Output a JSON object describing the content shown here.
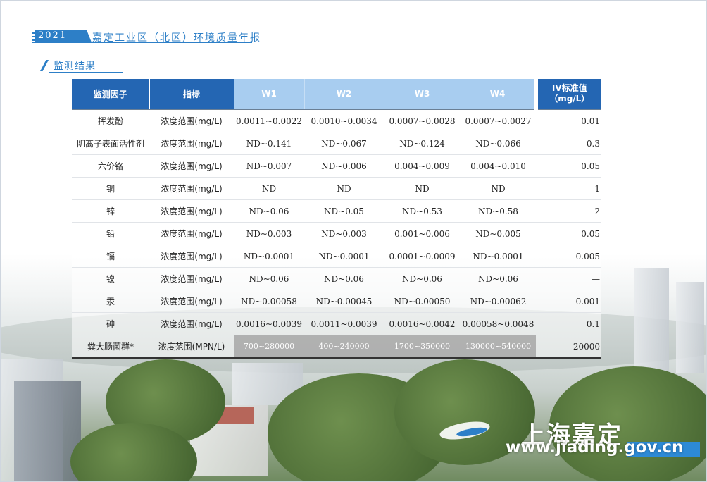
{
  "header": {
    "year": "2021",
    "title": "嘉定工业区（北区）环境质量年报"
  },
  "section": {
    "title": "监测结果"
  },
  "table": {
    "columns": [
      "监测因子",
      "指标",
      "W1",
      "W2",
      "W3",
      "W4"
    ],
    "standard_header": [
      "IV标准值",
      "（mg/L）"
    ],
    "rows": [
      [
        "挥发酚",
        "浓度范围(mg/L)",
        "0.0011~0.0022",
        "0.0010~0.0034",
        "0.0007~0.0028",
        "0.0007~0.0027",
        "0.01"
      ],
      [
        "阴离子表面活性剂",
        "浓度范围(mg/L)",
        "ND~0.141",
        "ND~0.067",
        "ND~0.124",
        "ND~0.066",
        "0.3"
      ],
      [
        "六价铬",
        "浓度范围(mg/L)",
        "ND~0.007",
        "ND~0.006",
        "0.004~0.009",
        "0.004~0.010",
        "0.05"
      ],
      [
        "铜",
        "浓度范围(mg/L)",
        "ND",
        "ND",
        "ND",
        "ND",
        "1"
      ],
      [
        "锌",
        "浓度范围(mg/L)",
        "ND~0.06",
        "ND~0.05",
        "ND~0.53",
        "ND~0.58",
        "2"
      ],
      [
        "铅",
        "浓度范围(mg/L)",
        "ND~0.003",
        "ND~0.003",
        "0.001~0.006",
        "ND~0.005",
        "0.05"
      ],
      [
        "镉",
        "浓度范围(mg/L)",
        "ND~0.0001",
        "ND~0.0001",
        "0.0001~0.0009",
        "ND~0.0001",
        "0.005"
      ],
      [
        "镍",
        "浓度范围(mg/L)",
        "ND~0.06",
        "ND~0.06",
        "ND~0.06",
        "ND~0.06",
        "—"
      ],
      [
        "汞",
        "浓度范围(mg/L)",
        "ND~0.00058",
        "ND~0.00045",
        "ND~0.00050",
        "ND~0.00062",
        "0.001"
      ],
      [
        "砷",
        "浓度范围(mg/L)",
        "0.0016~0.0039",
        "0.0011~0.0039",
        "0.0016~0.0042",
        "0.00058~0.0048",
        "0.1"
      ],
      [
        "粪大肠菌群*",
        "浓度范围(MPN/L)",
        "700~280000",
        "400~240000",
        "1700~350000",
        "130000~540000",
        "20000"
      ]
    ]
  },
  "footer": {
    "logo_cn": "上海嘉定",
    "url": "www.jiading.gov.cn"
  },
  "colors": {
    "accent": "#2d7fc7",
    "header_dark": "#2466b3",
    "header_light": "#a8cdf0"
  }
}
